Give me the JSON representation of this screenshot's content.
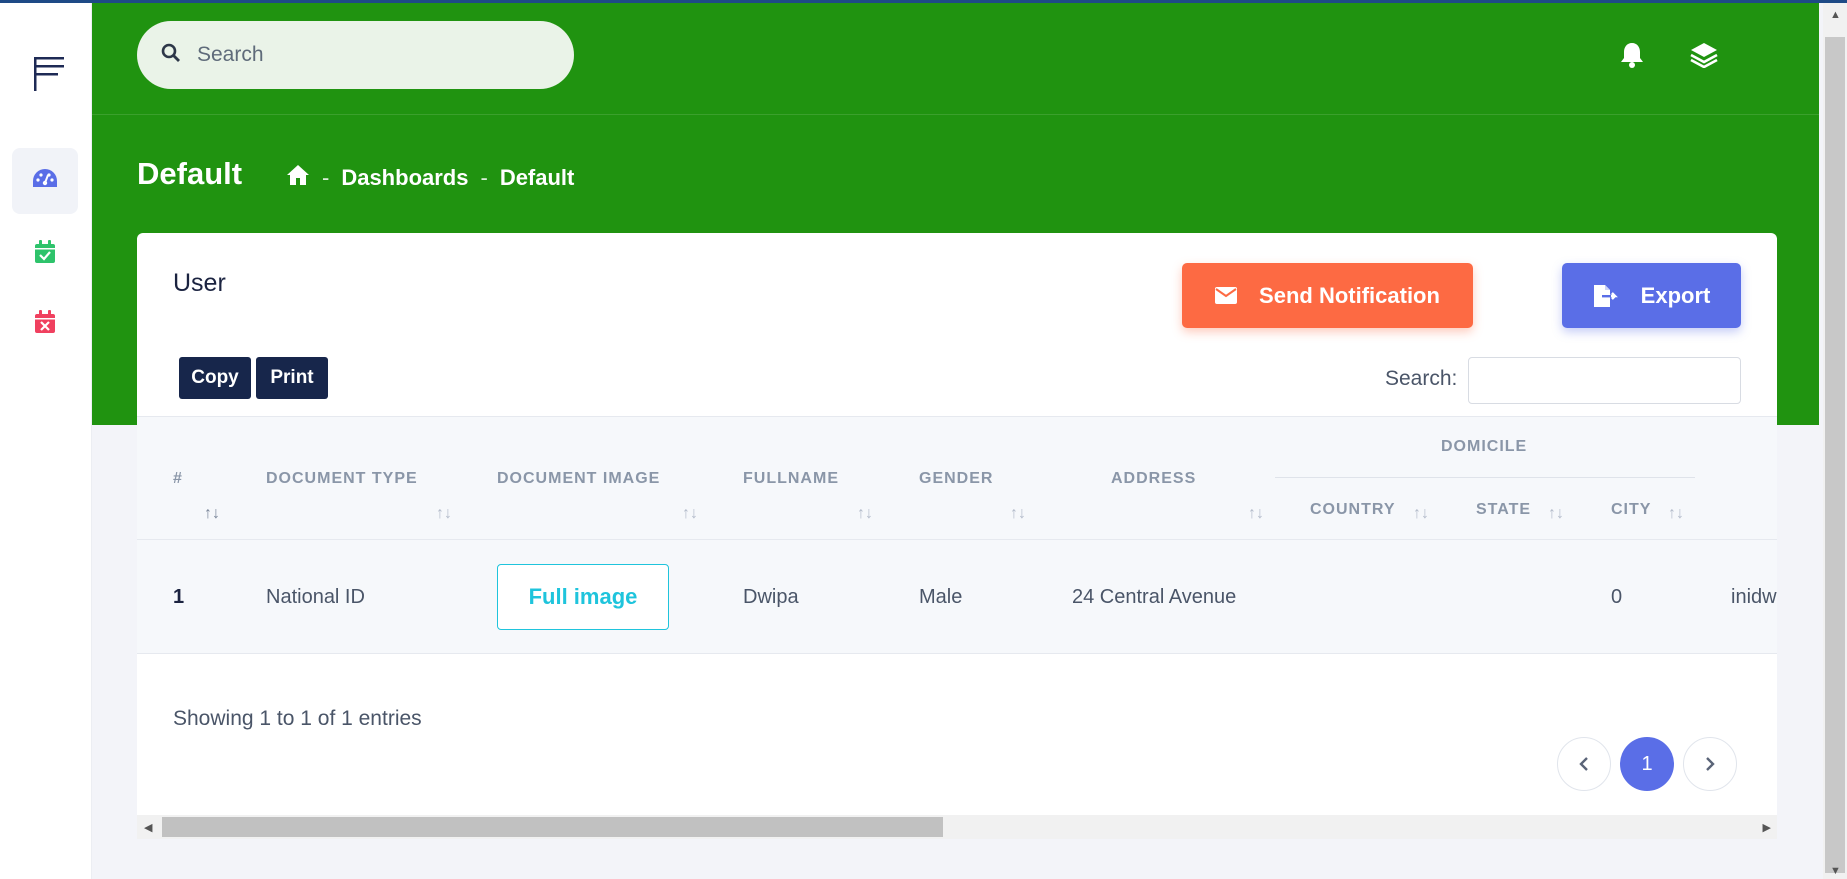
{
  "header": {
    "search_placeholder": "Search",
    "icons": [
      "bell-icon",
      "layers-icon"
    ]
  },
  "sidebar": {
    "items": [
      {
        "icon": "menu-icon"
      },
      {
        "icon": "gauge-icon",
        "active": true
      },
      {
        "icon": "calendar-check-icon"
      },
      {
        "icon": "calendar-times-icon"
      }
    ]
  },
  "page": {
    "title": "Default",
    "breadcrumb": [
      "Dashboards",
      "Default"
    ],
    "breadcrumb_sep": "-"
  },
  "card": {
    "title": "User",
    "send_notification_label": "Send Notification",
    "export_label": "Export",
    "copy_label": "Copy",
    "print_label": "Print",
    "search_label": "Search:",
    "search_value": ""
  },
  "table": {
    "group_header": "DOMICILE",
    "columns": [
      "#",
      "DOCUMENT TYPE",
      "DOCUMENT IMAGE",
      "FULLNAME",
      "GENDER",
      "ADDRESS",
      "COUNTRY",
      "STATE",
      "CITY"
    ],
    "rows": [
      {
        "num": "1",
        "document_type": "National ID",
        "document_image_button": "Full image",
        "fullname": "Dwipa",
        "gender": "Male",
        "address": "24 Central Avenue",
        "country": "",
        "state": "",
        "city": "0",
        "overflow": "inidw"
      }
    ]
  },
  "footer": {
    "info": "Showing 1 to 1 of 1 entries",
    "current_page": "1"
  },
  "colors": {
    "header_green": "#209310",
    "notify_orange": "#fd6a43",
    "export_blue": "#5a6ee7",
    "dark_navy": "#17264b",
    "cyan": "#1fc4dc"
  }
}
